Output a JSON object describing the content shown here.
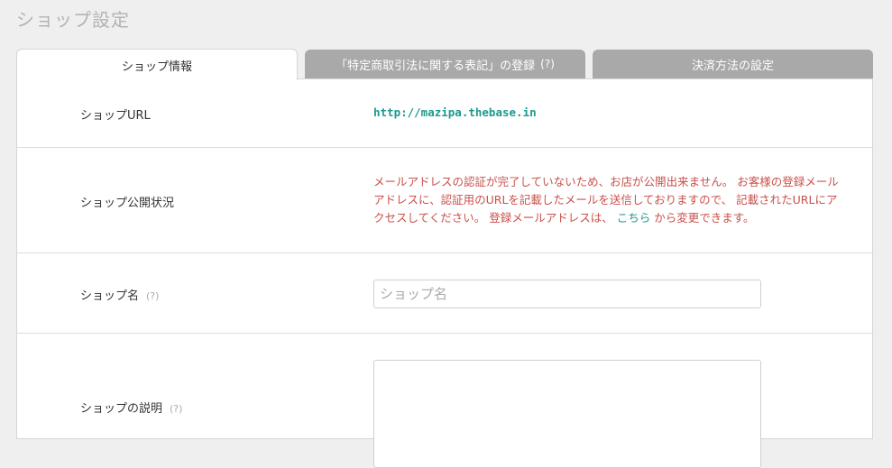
{
  "page": {
    "title": "ショップ設定"
  },
  "tabs": [
    {
      "label": "ショップ情報",
      "help": ""
    },
    {
      "label": "「特定商取引法に関する表記」の登録",
      "help": "(?)"
    },
    {
      "label": "決済方法の設定",
      "help": ""
    }
  ],
  "rows": {
    "url": {
      "label": "ショップURL",
      "value": "http://mazipa.thebase.in"
    },
    "status": {
      "label": "ショップ公開状況",
      "message_before": "メールアドレスの認証が完了していないため、お店が公開出来ません。 お客様の登録メールアドレスに、認証用のURLを記載したメールを送信しておりますので、 記載されたURLにアクセスしてください。 登録メールアドレスは、",
      "link": "こちら",
      "message_after": "から変更できます。"
    },
    "name": {
      "label": "ショップ名",
      "help": "(?)",
      "placeholder": "ショップ名",
      "value": ""
    },
    "description": {
      "label": "ショップの説明",
      "help": "(?)",
      "value": ""
    }
  },
  "colors": {
    "accent": "#1a9a8e",
    "warning": "#c9504a",
    "tab_inactive": "#a9a9a9",
    "background": "#efefef"
  }
}
